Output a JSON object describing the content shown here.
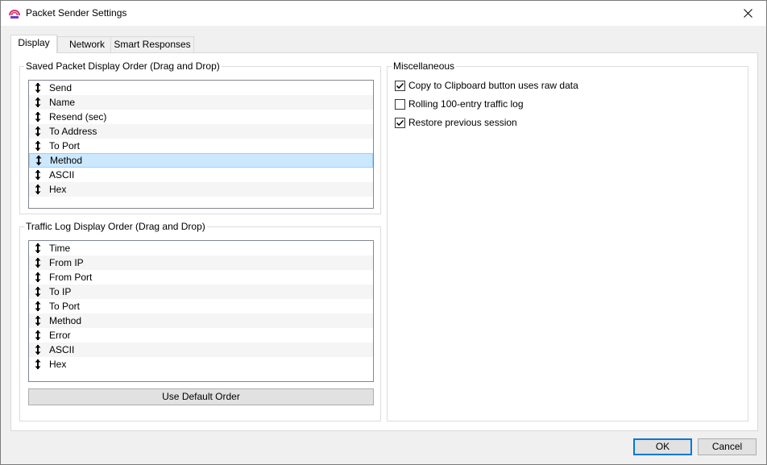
{
  "window": {
    "title": "Packet Sender Settings"
  },
  "tabs": [
    {
      "label": "Display"
    },
    {
      "label": "Network"
    },
    {
      "label": "Smart Responses"
    }
  ],
  "saved_packet": {
    "title": "Saved Packet Display Order (Drag and Drop)",
    "items": [
      "Send",
      "Name",
      "Resend (sec)",
      "To Address",
      "To Port",
      "Method",
      "ASCII",
      "Hex"
    ],
    "selected": "Method"
  },
  "traffic_log": {
    "title": "Traffic Log Display Order (Drag and Drop)",
    "items": [
      "Time",
      "From IP",
      "From Port",
      "To IP",
      "To Port",
      "Method",
      "Error",
      "ASCII",
      "Hex"
    ],
    "default_button": "Use Default Order"
  },
  "misc": {
    "title": "Miscellaneous",
    "options": [
      {
        "label": "Copy to Clipboard button uses raw data",
        "checked": true
      },
      {
        "label": "Rolling 100-entry traffic log",
        "checked": false
      },
      {
        "label": "Restore previous session",
        "checked": true
      }
    ]
  },
  "footer": {
    "ok_label": "OK",
    "cancel_label": "Cancel"
  },
  "colors": {
    "selection": "#cce8ff",
    "accent": "#0078d7"
  }
}
